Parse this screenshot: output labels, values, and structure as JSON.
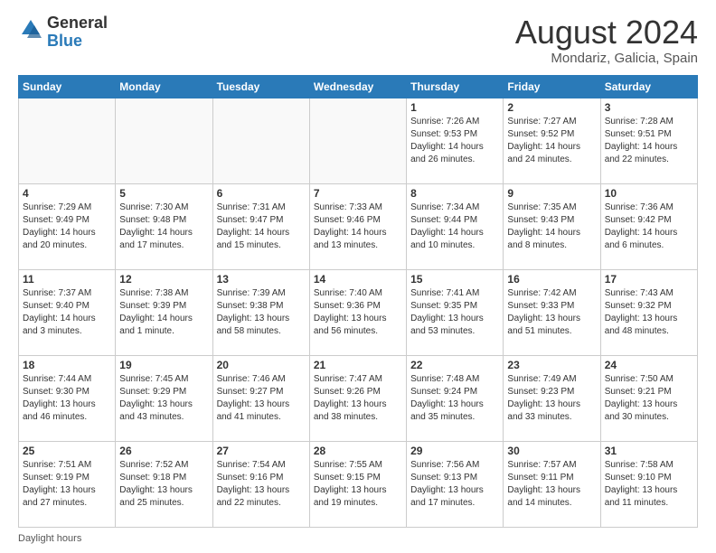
{
  "logo": {
    "general": "General",
    "blue": "Blue"
  },
  "title": "August 2024",
  "location": "Mondariz, Galicia, Spain",
  "days_of_week": [
    "Sunday",
    "Monday",
    "Tuesday",
    "Wednesday",
    "Thursday",
    "Friday",
    "Saturday"
  ],
  "footer": "Daylight hours",
  "weeks": [
    [
      {
        "day": "",
        "info": ""
      },
      {
        "day": "",
        "info": ""
      },
      {
        "day": "",
        "info": ""
      },
      {
        "day": "",
        "info": ""
      },
      {
        "day": "1",
        "info": "Sunrise: 7:26 AM\nSunset: 9:53 PM\nDaylight: 14 hours and 26 minutes."
      },
      {
        "day": "2",
        "info": "Sunrise: 7:27 AM\nSunset: 9:52 PM\nDaylight: 14 hours and 24 minutes."
      },
      {
        "day": "3",
        "info": "Sunrise: 7:28 AM\nSunset: 9:51 PM\nDaylight: 14 hours and 22 minutes."
      }
    ],
    [
      {
        "day": "4",
        "info": "Sunrise: 7:29 AM\nSunset: 9:49 PM\nDaylight: 14 hours and 20 minutes."
      },
      {
        "day": "5",
        "info": "Sunrise: 7:30 AM\nSunset: 9:48 PM\nDaylight: 14 hours and 17 minutes."
      },
      {
        "day": "6",
        "info": "Sunrise: 7:31 AM\nSunset: 9:47 PM\nDaylight: 14 hours and 15 minutes."
      },
      {
        "day": "7",
        "info": "Sunrise: 7:33 AM\nSunset: 9:46 PM\nDaylight: 14 hours and 13 minutes."
      },
      {
        "day": "8",
        "info": "Sunrise: 7:34 AM\nSunset: 9:44 PM\nDaylight: 14 hours and 10 minutes."
      },
      {
        "day": "9",
        "info": "Sunrise: 7:35 AM\nSunset: 9:43 PM\nDaylight: 14 hours and 8 minutes."
      },
      {
        "day": "10",
        "info": "Sunrise: 7:36 AM\nSunset: 9:42 PM\nDaylight: 14 hours and 6 minutes."
      }
    ],
    [
      {
        "day": "11",
        "info": "Sunrise: 7:37 AM\nSunset: 9:40 PM\nDaylight: 14 hours and 3 minutes."
      },
      {
        "day": "12",
        "info": "Sunrise: 7:38 AM\nSunset: 9:39 PM\nDaylight: 14 hours and 1 minute."
      },
      {
        "day": "13",
        "info": "Sunrise: 7:39 AM\nSunset: 9:38 PM\nDaylight: 13 hours and 58 minutes."
      },
      {
        "day": "14",
        "info": "Sunrise: 7:40 AM\nSunset: 9:36 PM\nDaylight: 13 hours and 56 minutes."
      },
      {
        "day": "15",
        "info": "Sunrise: 7:41 AM\nSunset: 9:35 PM\nDaylight: 13 hours and 53 minutes."
      },
      {
        "day": "16",
        "info": "Sunrise: 7:42 AM\nSunset: 9:33 PM\nDaylight: 13 hours and 51 minutes."
      },
      {
        "day": "17",
        "info": "Sunrise: 7:43 AM\nSunset: 9:32 PM\nDaylight: 13 hours and 48 minutes."
      }
    ],
    [
      {
        "day": "18",
        "info": "Sunrise: 7:44 AM\nSunset: 9:30 PM\nDaylight: 13 hours and 46 minutes."
      },
      {
        "day": "19",
        "info": "Sunrise: 7:45 AM\nSunset: 9:29 PM\nDaylight: 13 hours and 43 minutes."
      },
      {
        "day": "20",
        "info": "Sunrise: 7:46 AM\nSunset: 9:27 PM\nDaylight: 13 hours and 41 minutes."
      },
      {
        "day": "21",
        "info": "Sunrise: 7:47 AM\nSunset: 9:26 PM\nDaylight: 13 hours and 38 minutes."
      },
      {
        "day": "22",
        "info": "Sunrise: 7:48 AM\nSunset: 9:24 PM\nDaylight: 13 hours and 35 minutes."
      },
      {
        "day": "23",
        "info": "Sunrise: 7:49 AM\nSunset: 9:23 PM\nDaylight: 13 hours and 33 minutes."
      },
      {
        "day": "24",
        "info": "Sunrise: 7:50 AM\nSunset: 9:21 PM\nDaylight: 13 hours and 30 minutes."
      }
    ],
    [
      {
        "day": "25",
        "info": "Sunrise: 7:51 AM\nSunset: 9:19 PM\nDaylight: 13 hours and 27 minutes."
      },
      {
        "day": "26",
        "info": "Sunrise: 7:52 AM\nSunset: 9:18 PM\nDaylight: 13 hours and 25 minutes."
      },
      {
        "day": "27",
        "info": "Sunrise: 7:54 AM\nSunset: 9:16 PM\nDaylight: 13 hours and 22 minutes."
      },
      {
        "day": "28",
        "info": "Sunrise: 7:55 AM\nSunset: 9:15 PM\nDaylight: 13 hours and 19 minutes."
      },
      {
        "day": "29",
        "info": "Sunrise: 7:56 AM\nSunset: 9:13 PM\nDaylight: 13 hours and 17 minutes."
      },
      {
        "day": "30",
        "info": "Sunrise: 7:57 AM\nSunset: 9:11 PM\nDaylight: 13 hours and 14 minutes."
      },
      {
        "day": "31",
        "info": "Sunrise: 7:58 AM\nSunset: 9:10 PM\nDaylight: 13 hours and 11 minutes."
      }
    ]
  ]
}
